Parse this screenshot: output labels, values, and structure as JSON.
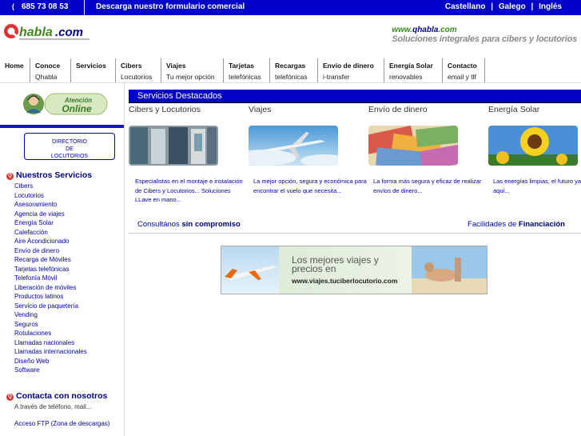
{
  "topbar": {
    "phone": "685 73 08 53",
    "form_link": "Descarga nuestro formulario comercial",
    "langs": [
      "Castellano",
      "Galego",
      "Inglés"
    ],
    "sep": "|"
  },
  "header": {
    "logo_text": "Qhabla.com",
    "url_prefix": "www.",
    "url_domain": "qhabla",
    "url_suffix": ".com",
    "tagline": "Soluciones integrales para cibers y locutorios"
  },
  "nav": [
    {
      "t1": "Home",
      "t2": ""
    },
    {
      "t1": "Conoce",
      "t2": "Qhabla"
    },
    {
      "t1": "Servicios",
      "t2": ""
    },
    {
      "t1": "Cibers",
      "t2": "Locutorios"
    },
    {
      "t1": "Viajes",
      "t2": "Tu mejor opción"
    },
    {
      "t1": "Tarjetas",
      "t2": "telefónicas"
    },
    {
      "t1": "Recargas",
      "t2": "telefónicas"
    },
    {
      "t1": "Envío de dinero",
      "t2": "i-transfer"
    },
    {
      "t1": "Energía Solar",
      "t2": "renovables"
    },
    {
      "t1": "Contacto",
      "t2": "email y tlf"
    }
  ],
  "sidebar": {
    "online_l1": "Atención",
    "online_l2": "Online",
    "directory": [
      "DIRECTORIO",
      "DE",
      "LOCUTORIOS"
    ],
    "services_title": "Nuestros Servicios",
    "services": [
      "Cibers",
      "Locutorios",
      "Asesoramiento",
      "Agencia de viajes",
      "Energía Solar",
      "Calefacción",
      "Aire Acondicionado",
      "Envío de dinero",
      "Recarga de Móviles",
      "Tarjetas telefónicas",
      "Telefonía Móvil",
      "Liberación de móviles",
      "Productos latinos",
      "Servicio de paquetería",
      "Vending",
      "Seguros",
      "Rotulaciones",
      "Llamadas nacionales",
      "Llamadas internacionales",
      "Diseño Web",
      "Software"
    ],
    "contact_title": "Contacta con nosotros",
    "contact_text": "A través de teléfono, mail...",
    "ftp": "Acceso FTP (Zona de descargas)"
  },
  "main": {
    "heading": "Servicios Destacados",
    "features": [
      {
        "title": "Cibers y Locutorios",
        "desc": "Especialistas en el montaje e instalación de Cibers y Locutorios... Soluciones LLave en mano..."
      },
      {
        "title": "Viajes",
        "desc": "La mejor opción, segura y económica para encontrar el vuelo que necesita..."
      },
      {
        "title": "Envío de dinero",
        "desc": "La forma más segura y eficaz de realizar envíos de dinero..."
      },
      {
        "title": "Energía Solar",
        "desc": "Las energías limpias, el futuro ya está aquí..."
      }
    ],
    "consult_pre": "Consultános",
    "consult_bold": "sin compromiso",
    "financ_pre": "Facilidades de",
    "financ_bold": "Financiación",
    "banner_l1": "Los mejores viajes y",
    "banner_l2": "precios en",
    "banner_url": "www.viajes.tuciberlocutorio.com"
  },
  "colors": {
    "brand_blue": "#0000c8",
    "link_blue": "#0000b0",
    "red": "#e03030",
    "green": "#3a8a1a"
  }
}
